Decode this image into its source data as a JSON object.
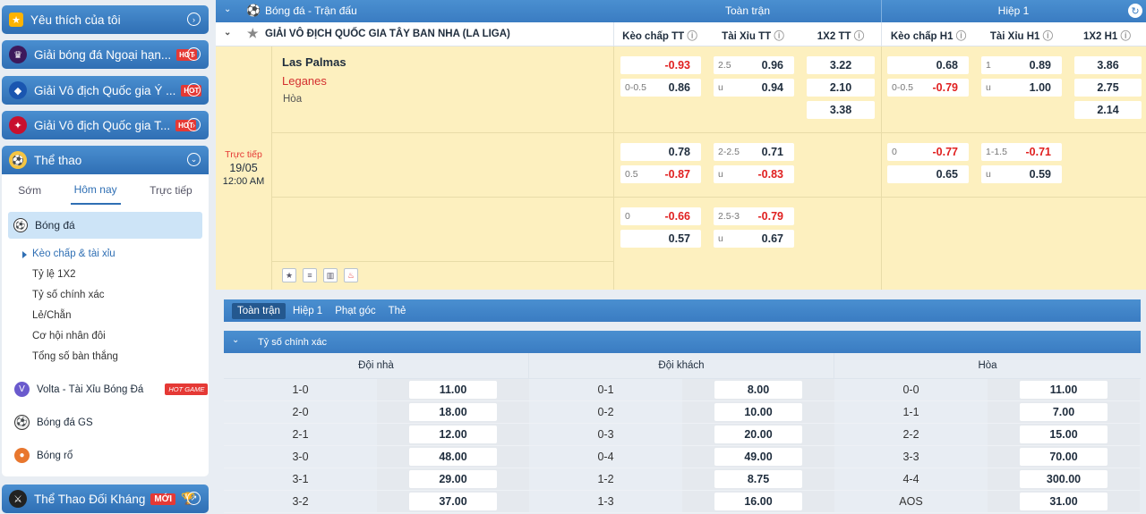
{
  "sidebar": {
    "favorites": "Yêu thích của tôi",
    "leagues": [
      {
        "label": "Giải bóng đá Ngoại hạn...",
        "hot": "HOT"
      },
      {
        "label": "Giải Vô địch Quốc gia Ý ...",
        "hot": "HOT"
      },
      {
        "label": "Giải Vô địch Quốc gia T...",
        "hot": "HOT"
      }
    ],
    "sports_title": "Thể thao",
    "tabs": [
      "Sớm",
      "Hôm nay",
      "Trực tiếp"
    ],
    "active_sport": "Bóng đá",
    "sub_items": [
      "Kèo chấp & tài xỉu",
      "Tỷ lệ 1X2",
      "Tỷ số chính xác",
      "Lẻ/Chẵn",
      "Cơ hội nhân đôi",
      "Tổng số bàn thắng"
    ],
    "other_sports": [
      {
        "label": "Volta - Tài Xỉu Bóng Đá",
        "badge": "HOT GAME"
      },
      {
        "label": "Bóng đá GS",
        "badge": ""
      },
      {
        "label": "Bóng rổ",
        "badge": ""
      }
    ],
    "versus": "Thể Thao Đối Kháng",
    "versus_badge": "MỚI"
  },
  "header": {
    "breadcrumb": "Bóng đá - Trận đấu",
    "full_time": "Toàn trận",
    "half_1": "Hiệp 1",
    "league": "GIẢI VÔ ĐỊCH QUỐC GIA TÂY BAN NHA (LA LIGA)",
    "cols": [
      "Kèo chấp TT",
      "Tài Xỉu TT",
      "1X2 TT",
      "Kèo chấp H1",
      "Tài Xỉu H1",
      "1X2 H1"
    ]
  },
  "match": {
    "home": "Las Palmas",
    "away": "Leganes",
    "draw": "Hòa",
    "status": "Trực tiếp",
    "date": "19/05",
    "time": "12:00 AM"
  },
  "odds": {
    "r1": {
      "hc_tt": [
        {
          "h": "",
          "v": "-0.93"
        },
        {
          "h": "0-0.5",
          "v": "0.86"
        }
      ],
      "ou_tt": [
        {
          "h": "2.5",
          "v": "0.96"
        },
        {
          "h": "u",
          "v": "0.94"
        }
      ],
      "x12_tt": [
        "3.22",
        "2.10",
        "3.38"
      ],
      "hc_h1": [
        {
          "h": "",
          "v": "0.68"
        },
        {
          "h": "0-0.5",
          "v": "-0.79"
        }
      ],
      "ou_h1": [
        {
          "h": "1",
          "v": "0.89"
        },
        {
          "h": "u",
          "v": "1.00"
        }
      ],
      "x12_h1": [
        "3.86",
        "2.75",
        "2.14"
      ]
    },
    "r2": {
      "hc_tt": [
        {
          "h": "",
          "v": "0.78"
        },
        {
          "h": "0.5",
          "v": "-0.87"
        }
      ],
      "ou_tt": [
        {
          "h": "2-2.5",
          "v": "0.71"
        },
        {
          "h": "u",
          "v": "-0.83"
        }
      ],
      "hc_h1": [
        {
          "h": "0",
          "v": "-0.77"
        },
        {
          "h": "",
          "v": "0.65"
        }
      ],
      "ou_h1": [
        {
          "h": "1-1.5",
          "v": "-0.71"
        },
        {
          "h": "u",
          "v": "0.59"
        }
      ]
    },
    "r3": {
      "hc_tt": [
        {
          "h": "0",
          "v": "-0.66"
        },
        {
          "h": "",
          "v": "0.57"
        }
      ],
      "ou_tt": [
        {
          "h": "2.5-3",
          "v": "-0.79"
        },
        {
          "h": "u",
          "v": "0.67"
        }
      ]
    }
  },
  "bottom": {
    "tabs": [
      "Toàn trận",
      "Hiệp 1",
      "Phạt góc",
      "Thẻ"
    ],
    "section": "Tỷ số chính xác",
    "columns": [
      "Đội nhà",
      "Đội khách",
      "Hòa"
    ],
    "home": [
      [
        "1-0",
        "11.00"
      ],
      [
        "2-0",
        "18.00"
      ],
      [
        "2-1",
        "12.00"
      ],
      [
        "3-0",
        "48.00"
      ],
      [
        "3-1",
        "29.00"
      ],
      [
        "3-2",
        "37.00"
      ]
    ],
    "away": [
      [
        "0-1",
        "8.00"
      ],
      [
        "0-2",
        "10.00"
      ],
      [
        "0-3",
        "20.00"
      ],
      [
        "0-4",
        "49.00"
      ],
      [
        "1-2",
        "8.75"
      ],
      [
        "1-3",
        "16.00"
      ]
    ],
    "draw": [
      [
        "0-0",
        "11.00"
      ],
      [
        "1-1",
        "7.00"
      ],
      [
        "2-2",
        "15.00"
      ],
      [
        "3-3",
        "70.00"
      ],
      [
        "4-4",
        "300.00"
      ],
      [
        "AOS",
        "31.00"
      ]
    ]
  },
  "colors": {
    "accent": "#3a7cc2",
    "match_bg": "#fdf0bf",
    "negative": "#e02020",
    "hot": "#e53935"
  }
}
